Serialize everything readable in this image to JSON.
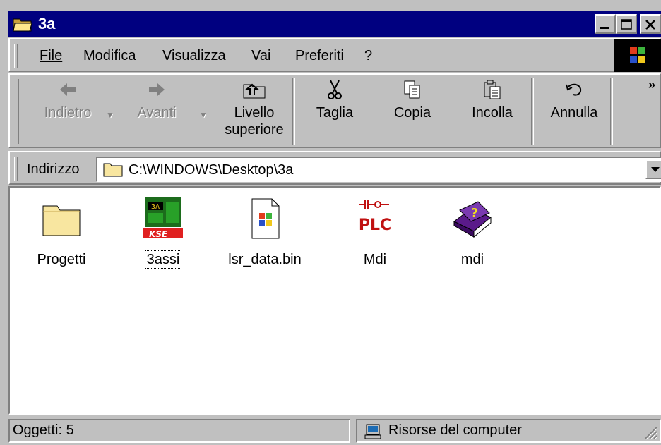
{
  "window": {
    "title": "3a"
  },
  "menu": {
    "items": [
      {
        "label": "File"
      },
      {
        "label": "Modifica"
      },
      {
        "label": "Visualizza"
      },
      {
        "label": "Vai"
      },
      {
        "label": "Preferiti"
      },
      {
        "label": "?"
      }
    ]
  },
  "toolbar": {
    "back": {
      "label": "Indietro",
      "icon": "back-arrow-icon",
      "enabled": false
    },
    "forward": {
      "label": "Avanti",
      "icon": "forward-arrow-icon",
      "enabled": false
    },
    "up": {
      "label_line1": "Livello",
      "label_line2": "superiore",
      "icon": "up-folder-icon"
    },
    "cut": {
      "label": "Taglia",
      "icon": "scissors-icon"
    },
    "copy": {
      "label": "Copia",
      "icon": "copy-icon"
    },
    "paste": {
      "label": "Incolla",
      "icon": "paste-icon"
    },
    "undo": {
      "label": "Annulla",
      "icon": "undo-icon"
    },
    "more": "»"
  },
  "address": {
    "label": "Indirizzo",
    "value": "C:\\WINDOWS\\Desktop\\3a"
  },
  "files": [
    {
      "name": "Progetti",
      "icon": "folder-icon"
    },
    {
      "name": "3assi",
      "icon": "3assi-app-icon",
      "focused": true
    },
    {
      "name": "lsr_data.bin",
      "icon": "windows-file-icon"
    },
    {
      "name": "Mdi",
      "icon": "plc-icon"
    },
    {
      "name": "mdi",
      "icon": "help-book-icon"
    }
  ],
  "status": {
    "objects": "Oggetti: 5",
    "zone": "Risorse del computer"
  },
  "colors": {
    "titlebar": "#000080",
    "face": "#c0c0c0",
    "folder": "#f8e6a0"
  }
}
